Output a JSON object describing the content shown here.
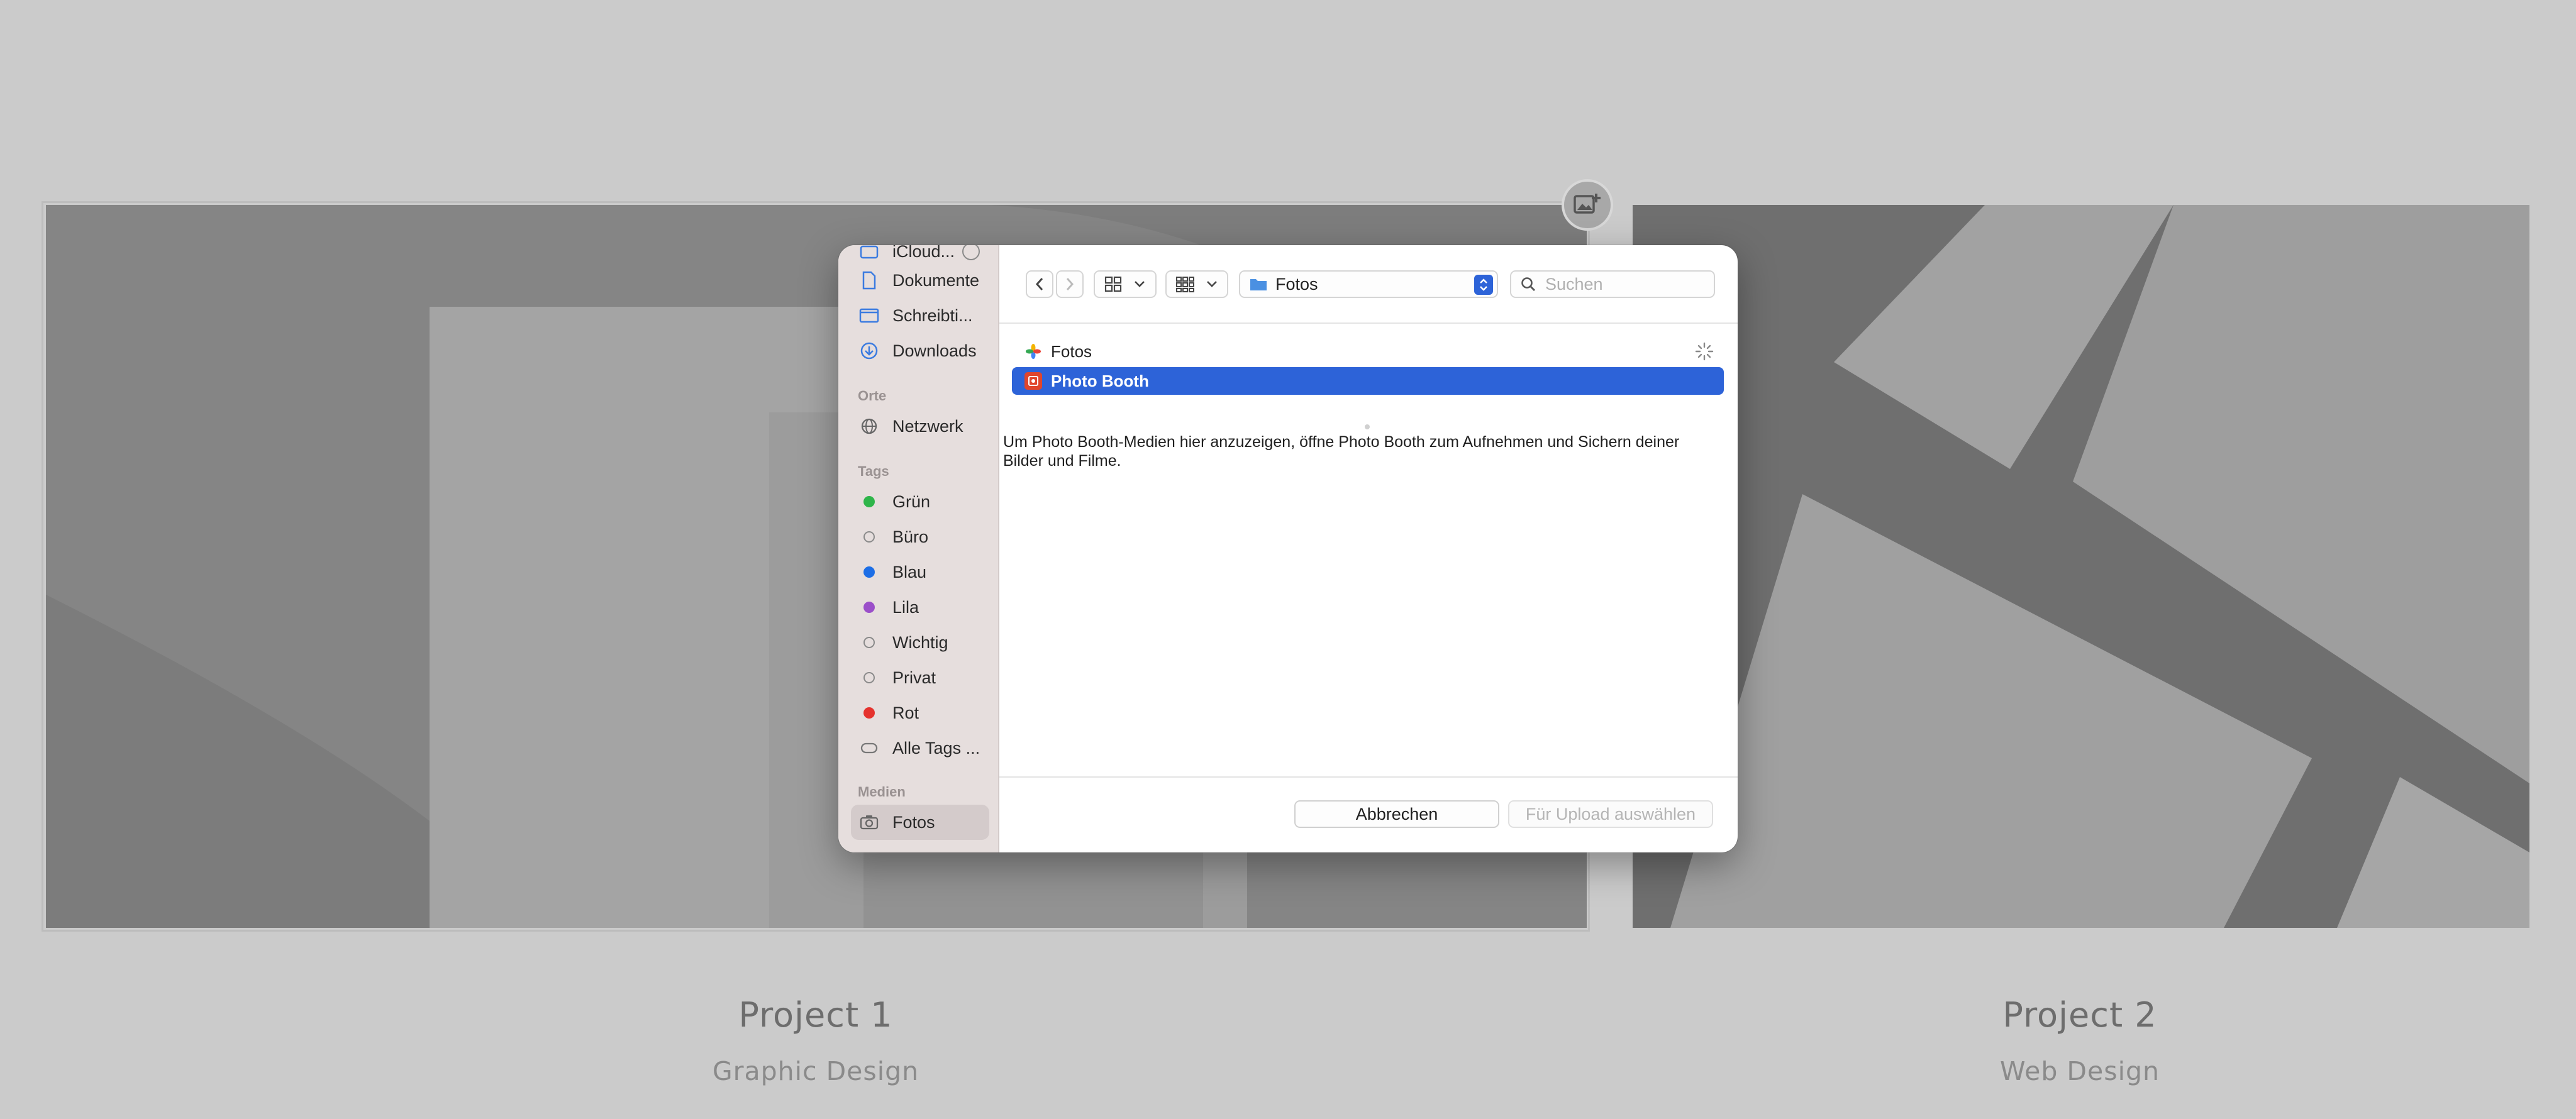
{
  "background": {
    "projects": [
      {
        "title": "Project 1",
        "subtitle": "Graphic Design"
      },
      {
        "title": "Project 2",
        "subtitle": "Web Design"
      }
    ],
    "add_image_icon": "image-plus-icon"
  },
  "dialog": {
    "sidebar": {
      "favorites": [
        {
          "label": "iCloud...",
          "icon": "icloud-folder-icon"
        },
        {
          "label": "Dokumente",
          "icon": "document-icon"
        },
        {
          "label": "Schreibti...",
          "icon": "desktop-icon"
        },
        {
          "label": "Downloads",
          "icon": "download-icon"
        }
      ],
      "places_header": "Orte",
      "places": [
        {
          "label": "Netzwerk",
          "icon": "globe-icon"
        }
      ],
      "tags_header": "Tags",
      "tags": [
        {
          "label": "Grün",
          "color": "#2fb54a"
        },
        {
          "label": "Büro",
          "color": ""
        },
        {
          "label": "Blau",
          "color": "#1d6ee6"
        },
        {
          "label": "Lila",
          "color": "#9b4fc9"
        },
        {
          "label": "Wichtig",
          "color": ""
        },
        {
          "label": "Privat",
          "color": ""
        },
        {
          "label": "Rot",
          "color": "#e5322d"
        },
        {
          "label": "Alle Tags ...",
          "color": ""
        }
      ],
      "media_header": "Medien",
      "media": [
        {
          "label": "Fotos",
          "icon": "camera-icon",
          "selected": true
        }
      ]
    },
    "toolbar": {
      "path": "Fotos",
      "search_placeholder": "Suchen"
    },
    "list": [
      {
        "label": "Fotos",
        "icon": "photos-app-icon",
        "selected": false
      },
      {
        "label": "Photo Booth",
        "icon": "photo-booth-icon",
        "selected": true
      }
    ],
    "message": "Um Photo Booth-Medien hier anzuzeigen, öffne Photo Booth zum Aufnehmen und Sichern deiner Bilder und Filme.",
    "buttons": {
      "cancel": "Abbrechen",
      "confirm": "Für Upload auswählen"
    },
    "accent": "#2d63d8"
  }
}
